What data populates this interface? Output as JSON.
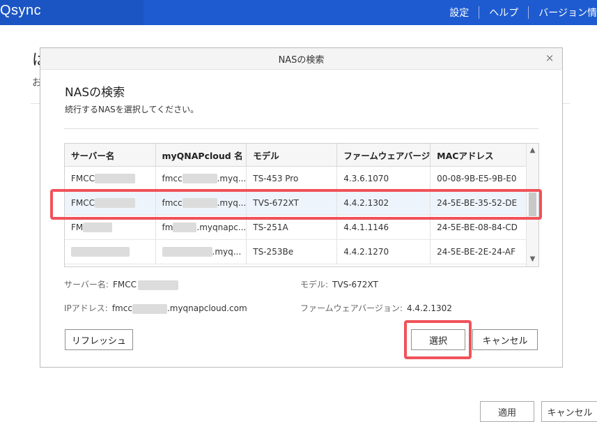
{
  "app": {
    "logo": "Qsync",
    "nav": [
      "設定",
      "ヘルプ",
      "バージョン情"
    ]
  },
  "background": {
    "heading": "は",
    "subtext": "お",
    "apply_label": "適用",
    "cancel_label": "キャンセル"
  },
  "dialog": {
    "title": "NASの検索",
    "close_icon": "×",
    "heading": "NASの検索",
    "description": "続行するNASを選択してください。",
    "columns": [
      "サーバー名",
      "myQNAPcloud 名",
      "モデル",
      "ファームウェアバージ",
      "MACアドレス"
    ],
    "rows": [
      {
        "server": "FMCC",
        "cloud": "fmcc",
        "cloud_suffix": ".myq...",
        "model": "TS-453 Pro",
        "firmware": "4.3.6.1070",
        "mac": "00-08-9B-E5-9B-E0",
        "selected": false
      },
      {
        "server": "FMCC",
        "cloud": "fmcc",
        "cloud_suffix": ".myq...",
        "model": "TVS-672XT",
        "firmware": "4.4.2.1302",
        "mac": "24-5E-BE-35-52-DE",
        "selected": true
      },
      {
        "server": "FM",
        "cloud": "fm",
        "cloud_suffix": ".myqnapc...",
        "model": "TS-251A",
        "firmware": "4.4.1.1146",
        "mac": "24-5E-BE-08-84-CD",
        "selected": false
      },
      {
        "server": "",
        "cloud": "",
        "cloud_suffix": ".myq...",
        "model": "TS-253Be",
        "firmware": "4.4.2.1270",
        "mac": "24-5E-BE-2E-24-AF",
        "selected": false
      }
    ],
    "details": {
      "server_label": "サーバー名:",
      "server_value": "FMCC",
      "model_label": "モデル:",
      "model_value": "TVS-672XT",
      "ip_label": "IPアドレス:",
      "ip_prefix": "fmcc",
      "ip_suffix": ".myqnapcloud.com",
      "firmware_label": "ファームウェアバージョン:",
      "firmware_value": "4.4.2.1302"
    },
    "refresh_label": "リフレッシュ",
    "select_label": "選択",
    "cancel_label": "キャンセル"
  },
  "colors": {
    "topbar": "#1e5bd0",
    "highlight": "#f0525a",
    "selected_row": "#eef4fb"
  }
}
